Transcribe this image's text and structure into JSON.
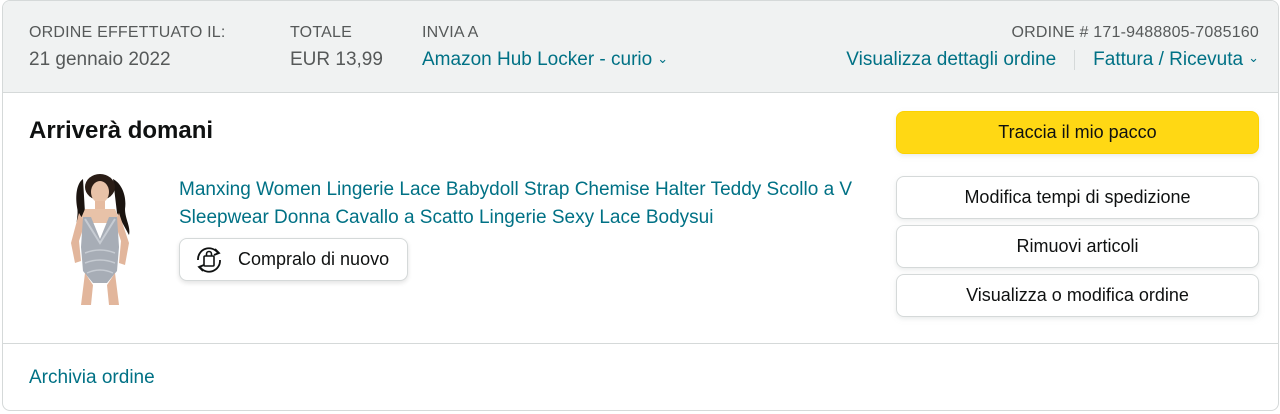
{
  "header": {
    "date_label": "ORDINE EFFETTUATO IL:",
    "date_value": "21 gennaio 2022",
    "total_label": "TOTALE",
    "total_value": "EUR 13,99",
    "ship_label": "INVIA A",
    "ship_value": "Amazon Hub Locker - curio",
    "order_number_label": "ORDINE # 171-9488805-7085160",
    "details_link": "Visualizza dettagli ordine",
    "invoice_link": "Fattura / Ricevuta"
  },
  "delivery": {
    "status": "Arriverà domani"
  },
  "product": {
    "title": "Manxing Women Lingerie Lace Babydoll Strap Chemise Halter Teddy Scollo a V Sleepwear Donna Cavallo a Scatto Lingerie Sexy Lace Bodysui",
    "buy_again_label": "Compralo di nuovo"
  },
  "actions": {
    "track": "Traccia il mio pacco",
    "change_shipping": "Modifica tempi di spedizione",
    "remove_items": "Rimuovi articoli",
    "view_edit": "Visualizza o modifica ordine"
  },
  "footer": {
    "archive": "Archivia ordine"
  },
  "colors": {
    "link": "#007185",
    "primary_button": "#ffd814",
    "header_bg": "#f0f2f2"
  },
  "icons": {
    "chevron": "chevron-down-icon",
    "buy_again": "buy-again-icon"
  }
}
